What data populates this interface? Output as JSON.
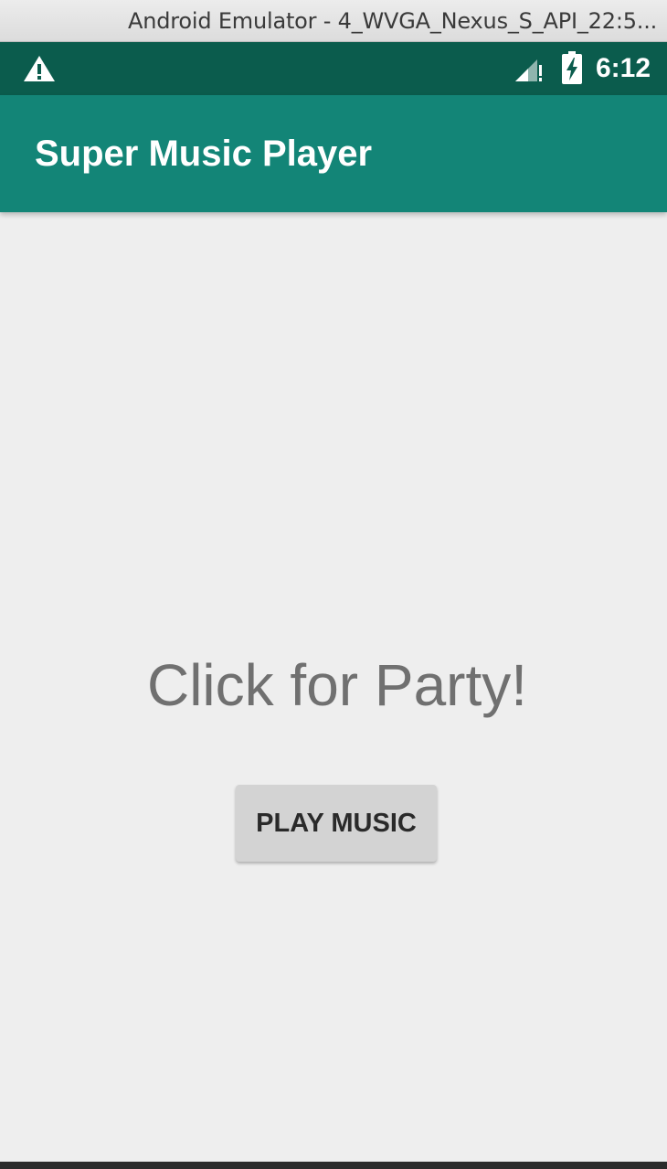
{
  "window": {
    "title": "Android Emulator - 4_WVGA_Nexus_S_API_22:5..."
  },
  "status_bar": {
    "time": "6:12",
    "icons": [
      "warning-icon",
      "signal-icon",
      "battery-charging-icon"
    ],
    "background": "#0b5c4d"
  },
  "app_bar": {
    "title": "Super Music Player",
    "background": "#138577"
  },
  "main": {
    "message": "Click for Party!",
    "play_button_label": "PLAY MUSIC"
  },
  "colors": {
    "content_background": "#eeeeee",
    "message_text": "#707070",
    "button_background": "#d3d3d3"
  }
}
